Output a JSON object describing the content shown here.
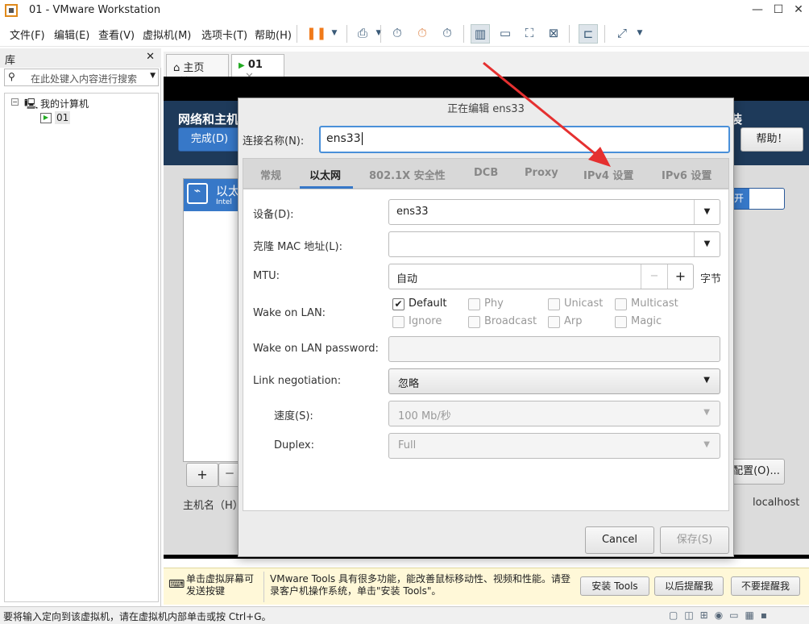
{
  "window": {
    "title": "01 - VMware Workstation"
  },
  "menu": [
    "文件(F)",
    "编辑(E)",
    "查看(V)",
    "虚拟机(M)",
    "选项卡(T)",
    "帮助(H)"
  ],
  "library": {
    "title": "库",
    "search_placeholder": "在此处键入内容进行搜索",
    "root": "我的计算机",
    "vm": "01"
  },
  "tabs": {
    "home": "主页",
    "vm": "01"
  },
  "gnome": {
    "header": "网络和主机",
    "done": "完成(D)",
    "help": "帮助！",
    "hostname_label": "主机名（H）：",
    "hostname": "localhost",
    "iface_label": "以太",
    "iface_sub": "Intel",
    "config_btn": "配置(O)...",
    "add": "+",
    "remove": "－",
    "toggle": "开",
    "header_right": "装"
  },
  "dialog": {
    "title": "正在编辑 ens33",
    "conn_label": "连接名称(N):",
    "conn_value": "ens33",
    "tabs": [
      "常规",
      "以太网",
      "802.1X 安全性",
      "DCB",
      "Proxy",
      "IPv4 设置",
      "IPv6 设置"
    ],
    "device_label": "设备(D):",
    "device": "ens33",
    "mac_label": "克隆 MAC 地址(L):",
    "mac": "",
    "mtu_label": "MTU:",
    "mtu": "自动",
    "mtu_unit": "字节",
    "minus": "−",
    "plus": "+",
    "wol_label": "Wake on LAN:",
    "wol": [
      {
        "label": "Default",
        "checked": true
      },
      {
        "label": "Phy",
        "checked": false
      },
      {
        "label": "Unicast",
        "checked": false
      },
      {
        "label": "Multicast",
        "checked": false
      },
      {
        "label": "Ignore",
        "checked": false
      },
      {
        "label": "Broadcast",
        "checked": false
      },
      {
        "label": "Arp",
        "checked": false
      },
      {
        "label": "Magic",
        "checked": false
      }
    ],
    "wolpw_label": "Wake on LAN password:",
    "link_label": "Link negotiation:",
    "link": "忽略",
    "speed_label": "速度(S):",
    "speed": "100 Mb/秒",
    "duplex_label": "Duplex:",
    "duplex": "Full",
    "cancel": "Cancel",
    "save": "保存(S)"
  },
  "notification": {
    "left": "单击虚拟屏幕可发送按键",
    "text": "VMware Tools 具有很多功能，能改善鼠标移动性、视频和性能。请登录客户机操作系统，单击\"安装 Tools\"。",
    "install": "安装 Tools",
    "later": "以后提醒我",
    "never": "不要提醒我"
  },
  "status": "要将输入定向到该虚拟机，请在虚拟机内部单击或按 Ctrl+G。"
}
